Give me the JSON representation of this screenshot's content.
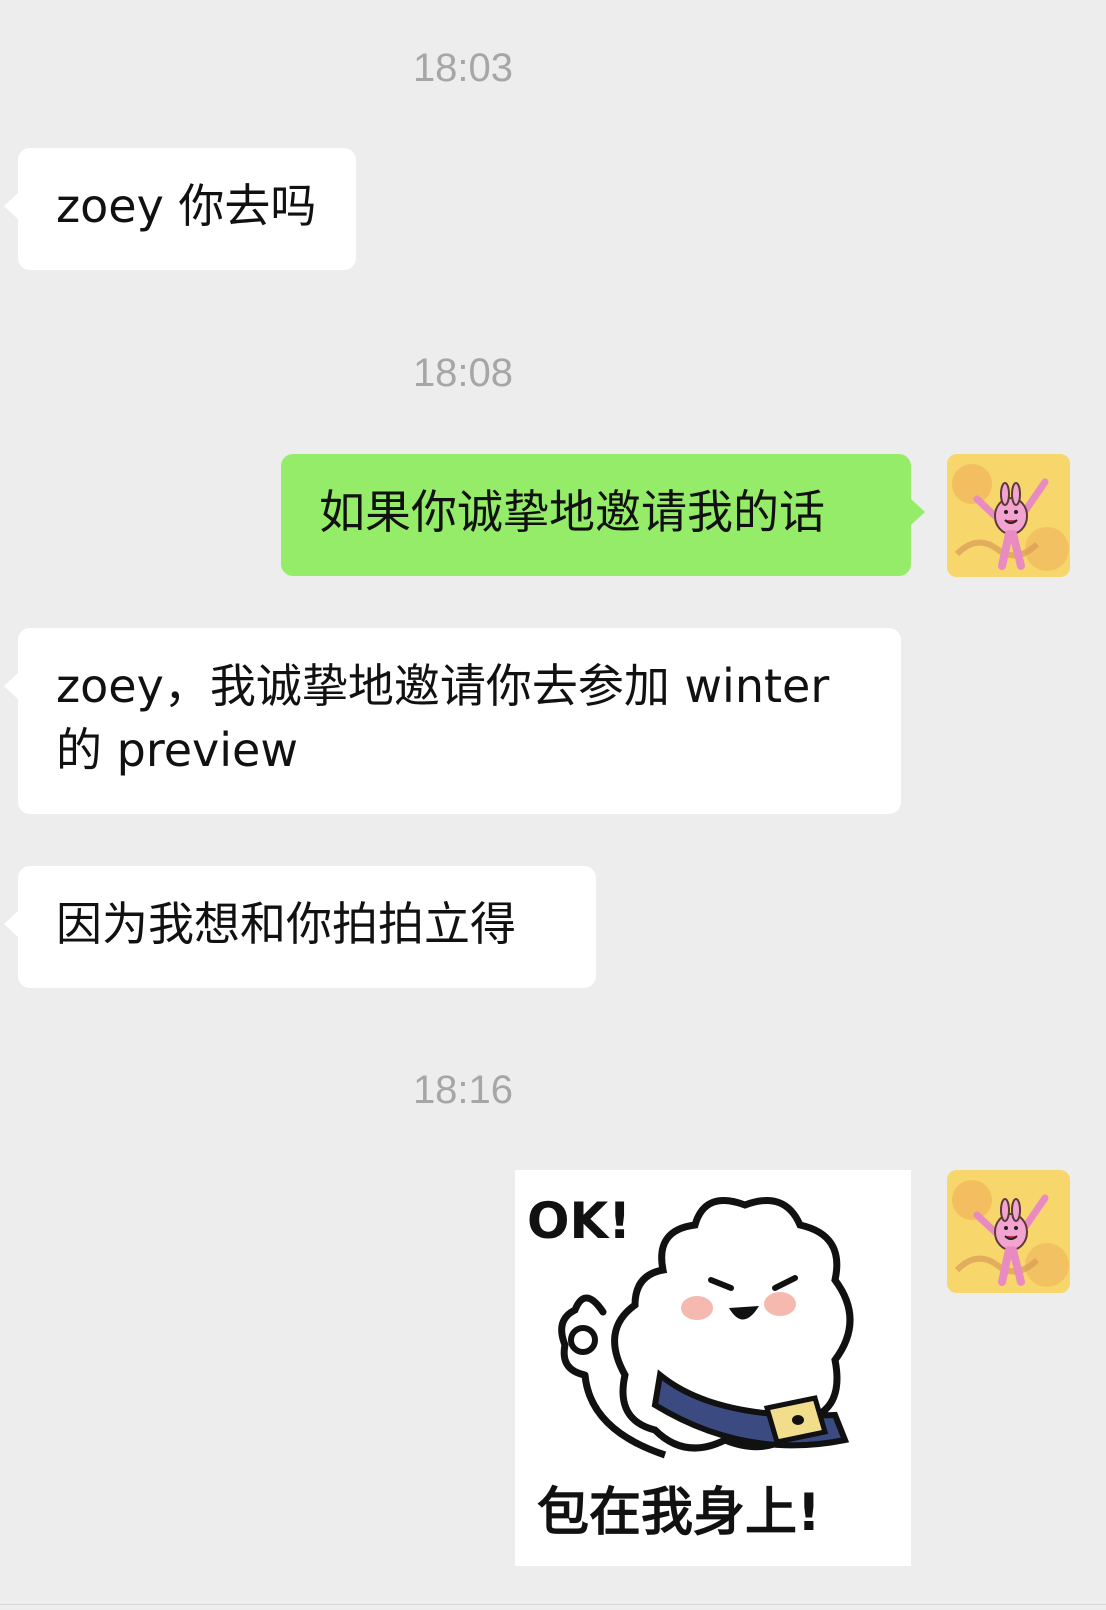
{
  "messages": [
    {
      "type": "time",
      "text": "18:03"
    },
    {
      "type": "incoming",
      "text": "zoey 你去吗"
    },
    {
      "type": "time",
      "text": "18:08"
    },
    {
      "type": "outgoing",
      "text": "如果你诚挚地邀请我的话"
    },
    {
      "type": "incoming",
      "lines": [
        "zoey，我诚挚地邀请你去参加 winter",
        "的 preview"
      ]
    },
    {
      "type": "incoming",
      "text": "因为我想和你拍拍立得"
    },
    {
      "type": "time",
      "text": "18:16"
    },
    {
      "type": "outgoing-sticker",
      "sticker": {
        "top_text": "OK!",
        "bottom_text": "包在我身上!",
        "icon": "cloud-mascot-ok-sticker"
      }
    }
  ],
  "avatar": {
    "icon": "pink-rabbit-avatar-icon"
  },
  "colors": {
    "background": "#ededed",
    "incoming_bubble": "#ffffff",
    "outgoing_bubble": "#95ec69",
    "timestamp_text": "#a6a6a6"
  }
}
